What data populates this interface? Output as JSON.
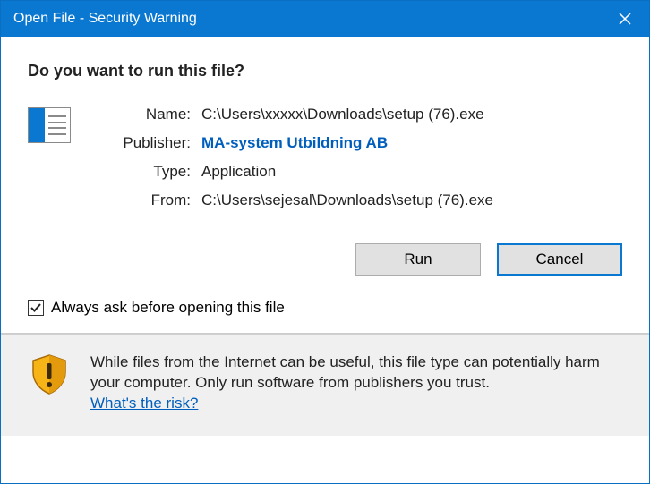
{
  "titlebar": {
    "title": "Open File - Security Warning"
  },
  "heading": "Do you want to run this file?",
  "fields": {
    "name_label": "Name:",
    "name_value": "C:\\Users\\xxxxx\\Downloads\\setup (76).exe",
    "publisher_label": "Publisher:",
    "publisher_value": "MA-system Utbildning AB",
    "type_label": "Type:",
    "type_value": "Application",
    "from_label": "From:",
    "from_value": "C:\\Users\\sejesal\\Downloads\\setup (76).exe"
  },
  "buttons": {
    "run": "Run",
    "cancel": "Cancel"
  },
  "checkbox": {
    "label": "Always ask before opening this file",
    "checked": true
  },
  "warning": {
    "text": "While files from the Internet can be useful, this file type can potentially harm your computer. Only run software from publishers you trust.",
    "link": "What's the risk?"
  }
}
